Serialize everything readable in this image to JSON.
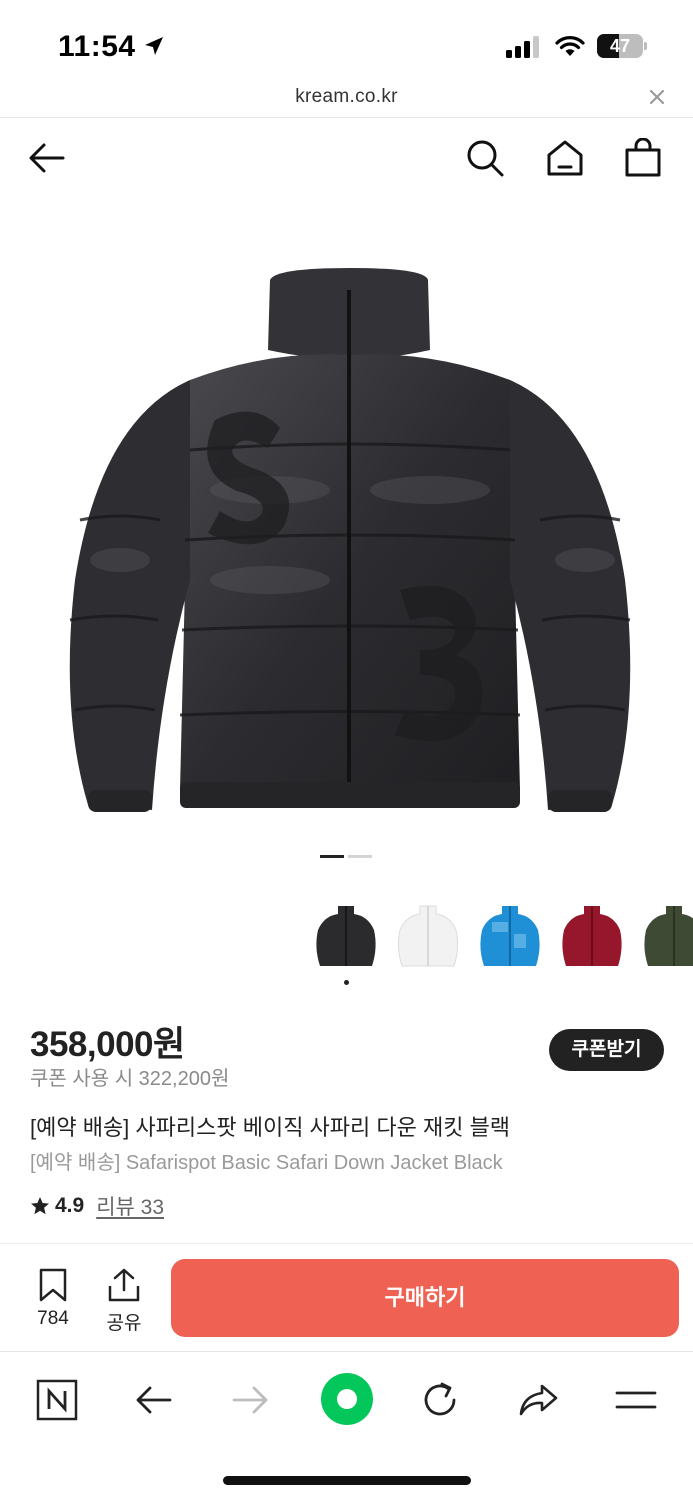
{
  "status_bar": {
    "time": "11:54",
    "battery_level": "47",
    "battery_fraction": 0.47
  },
  "url_bar": {
    "url": "kream.co.kr"
  },
  "product": {
    "price": "358,000원",
    "coupon_price_text": "쿠폰 사용 시 322,200원",
    "coupon_button": "쿠폰받기",
    "title_ko": "[예약 배송] 사파리스팟 베이직 사파리 다운 재킷 블랙",
    "title_en": "[예약 배송] Safarispot Basic Safari Down Jacket Black",
    "rating": "4.9",
    "reviews_label": "리뷰 33"
  },
  "image_pager": {
    "count": 2,
    "active": 1
  },
  "color_thumbs": [
    {
      "color": "black",
      "hex": "#2b2b2d"
    },
    {
      "color": "white",
      "hex": "#f2f2f2"
    },
    {
      "color": "blue",
      "hex": "#1f8fd6"
    },
    {
      "color": "burgundy",
      "hex": "#96172b"
    },
    {
      "color": "olive",
      "hex": "#3f4a35"
    }
  ],
  "action_bar": {
    "bookmark_count": "784",
    "share_label": "공유",
    "buy_label": "구매하기",
    "buy_color": "#ef6253"
  },
  "browser_toolbar": {
    "icons": [
      "naver-icon",
      "back-arrow-icon",
      "forward-arrow-icon",
      "green-dot-icon",
      "reload-icon",
      "share-icon",
      "menu-icon"
    ],
    "accent": "#03c75a"
  }
}
